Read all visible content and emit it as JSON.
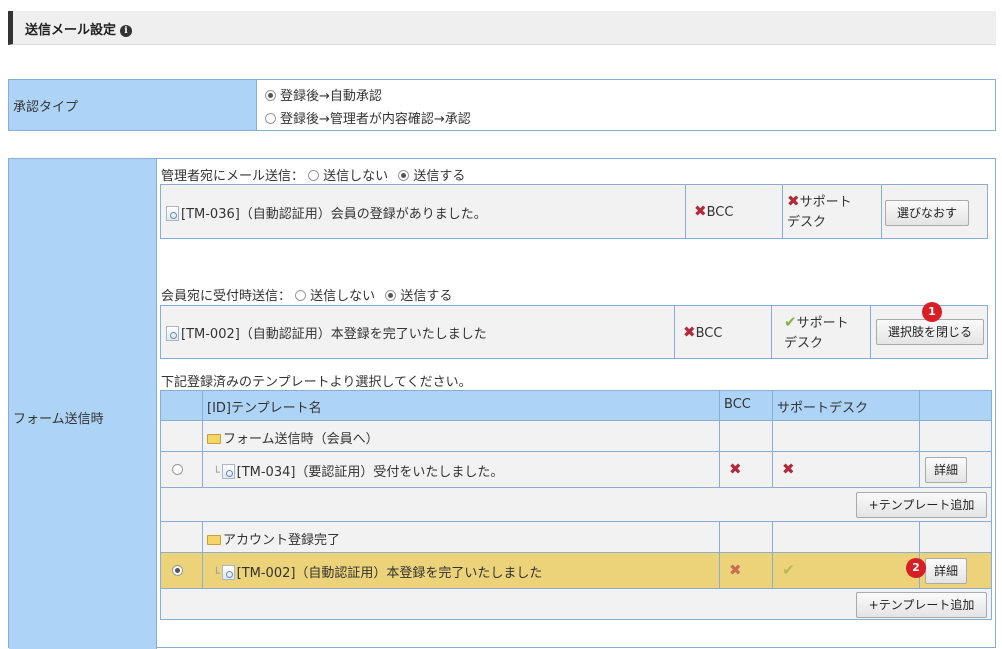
{
  "header": {
    "title": "送信メール設定",
    "info_glyph": "i"
  },
  "approval": {
    "label": "承認タイプ",
    "options": [
      {
        "label": "登録後→自動承認",
        "selected": true
      },
      {
        "label": "登録後→管理者が内容確認→承認",
        "selected": false
      }
    ]
  },
  "form_send": {
    "label": "フォーム送信時",
    "admin": {
      "prompt": "管理者宛にメール送信：",
      "opt_no": "送信しない",
      "opt_yes": "送信する",
      "selected": "yes",
      "template": "[TM-036]（自動認証用）会員の登録がありました。",
      "bcc": "BCC",
      "support": "サポート",
      "support2": "デスク",
      "button": "選びなおす"
    },
    "member": {
      "prompt": "会員宛に受付時送信：",
      "opt_no": "送信しない",
      "opt_yes": "送信する",
      "selected": "yes",
      "template": "[TM-002]（自動認証用）本登録を完了いたしました",
      "bcc": "BCC",
      "support": "サポート",
      "support2": "デスク",
      "button": "選択肢を閉じる",
      "marker": "1"
    },
    "list_prompt": "下記登録済みのテンプレートより選択してください。",
    "table": {
      "col_name": "[ID]テンプレート名",
      "col_bcc": "BCC",
      "col_support": "サポートデスク",
      "folder1": "フォーム送信時（会員へ）",
      "row1": {
        "name": "[TM-034]（要認証用）受付をいたしました。",
        "detail": "詳細"
      },
      "add1": "+テンプレート追加",
      "folder2": "アカウント登録完了",
      "row2": {
        "name": "[TM-002]（自動認証用）本登録を完了いたしました",
        "detail": "詳細",
        "marker": "2"
      },
      "add2": "+テンプレート追加"
    }
  },
  "colors": {
    "label_bg": "#add4f6",
    "border": "#8aaed3",
    "highlight": "#ecd37a",
    "marker": "#d81f26"
  }
}
